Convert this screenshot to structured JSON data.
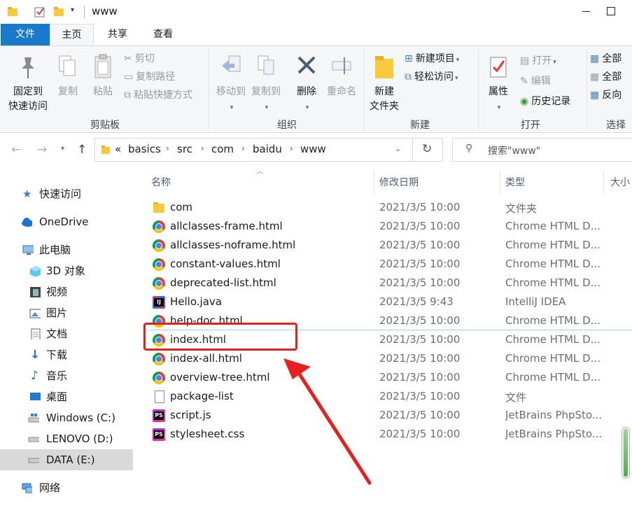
{
  "window": {
    "title": "www"
  },
  "ribbon_tabs": [
    "文件",
    "主页",
    "共享",
    "查看"
  ],
  "ribbon": {
    "clipboard": {
      "pin_label_1": "固定到",
      "pin_label_2": "快速访问",
      "copy": "复制",
      "paste": "粘贴",
      "cut": "剪切",
      "copy_path": "复制路径",
      "paste_shortcut": "粘贴快捷方式",
      "group": "剪贴板"
    },
    "organize": {
      "move_to": "移动到",
      "copy_to": "复制到",
      "delete": "删除",
      "rename": "重命名",
      "group": "组织"
    },
    "new": {
      "new_folder_1": "新建",
      "new_folder_2": "文件夹",
      "new_item": "新建项目",
      "easy_access": "轻松访问",
      "group": "新建"
    },
    "open": {
      "properties": "属性",
      "open": "打开",
      "edit": "编辑",
      "history": "历史记录",
      "group": "打开"
    },
    "select": {
      "select_all": "全部",
      "select_none": "全部",
      "invert": "反向",
      "group": "选择"
    }
  },
  "address": {
    "crumbs": [
      "basics",
      "src",
      "com",
      "baidu",
      "www"
    ],
    "overflow": "«",
    "search_placeholder": "搜索\"www\""
  },
  "nav_pane": {
    "quick_access": "快速访问",
    "onedrive": "OneDrive",
    "this_pc": "此电脑",
    "items": [
      "3D 对象",
      "视频",
      "图片",
      "文档",
      "下载",
      "音乐",
      "桌面",
      "Windows (C:)",
      "LENOVO (D:)",
      "DATA (E:)"
    ],
    "network": "网络"
  },
  "columns": {
    "name": "名称",
    "date": "修改日期",
    "type": "类型",
    "size": "大小"
  },
  "files": [
    {
      "name": "com",
      "date": "2021/3/5 10:00",
      "type": "文件夹",
      "icon": "folder"
    },
    {
      "name": "allclasses-frame.html",
      "date": "2021/3/5 10:00",
      "type": "Chrome HTML D...",
      "icon": "chrome"
    },
    {
      "name": "allclasses-noframe.html",
      "date": "2021/3/5 10:00",
      "type": "Chrome HTML D...",
      "icon": "chrome"
    },
    {
      "name": "constant-values.html",
      "date": "2021/3/5 10:00",
      "type": "Chrome HTML D...",
      "icon": "chrome"
    },
    {
      "name": "deprecated-list.html",
      "date": "2021/3/5 10:00",
      "type": "Chrome HTML D...",
      "icon": "chrome"
    },
    {
      "name": "Hello.java",
      "date": "2021/3/5 9:43",
      "type": "IntelliJ IDEA",
      "icon": "intellij"
    },
    {
      "name": "help-doc.html",
      "date": "2021/3/5 10:00",
      "type": "Chrome HTML D...",
      "icon": "chrome"
    },
    {
      "name": "index.html",
      "date": "2021/3/5 10:00",
      "type": "Chrome HTML D...",
      "icon": "chrome"
    },
    {
      "name": "index-all.html",
      "date": "2021/3/5 10:00",
      "type": "Chrome HTML D...",
      "icon": "chrome"
    },
    {
      "name": "overview-tree.html",
      "date": "2021/3/5 10:00",
      "type": "Chrome HTML D...",
      "icon": "chrome"
    },
    {
      "name": "package-list",
      "date": "2021/3/5 10:00",
      "type": "文件",
      "icon": "file"
    },
    {
      "name": "script.js",
      "date": "2021/3/5 10:00",
      "type": "JetBrains PhpSto...",
      "icon": "phpstorm"
    },
    {
      "name": "stylesheet.css",
      "date": "2021/3/5 10:00",
      "type": "JetBrains PhpSto...",
      "icon": "phpstorm"
    }
  ],
  "colors": {
    "file_tab": "#1979ca",
    "annotation_red": "#e8201d"
  }
}
